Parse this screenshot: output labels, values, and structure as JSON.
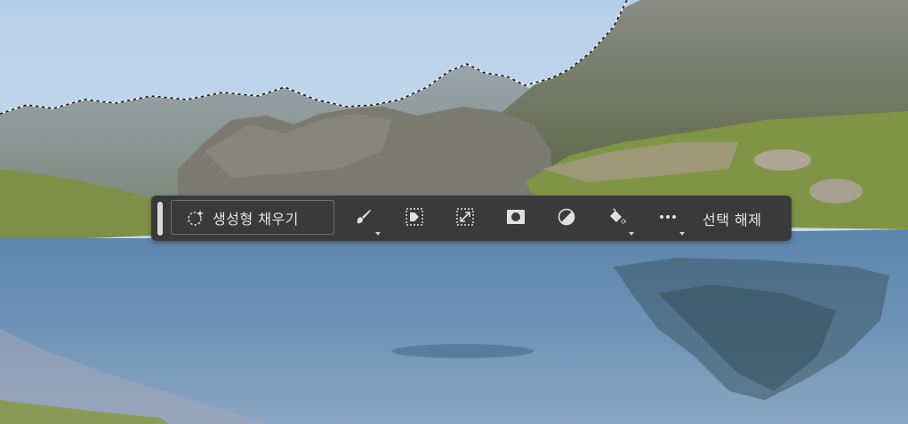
{
  "toolbar": {
    "generative_fill_label": "생성형 채우기",
    "deselect_label": "선택 해제",
    "icons": [
      "sparkle-icon",
      "brush-icon",
      "invert-selection-icon",
      "transform-selection-icon",
      "mask-icon",
      "adjustment-icon",
      "fill-bucket-icon",
      "more-icon"
    ]
  },
  "colors": {
    "toolbar_bg": "#3a3a3a",
    "icon": "#e0e0e0",
    "sky": "#c9dcee",
    "water": "#5f86ad"
  }
}
